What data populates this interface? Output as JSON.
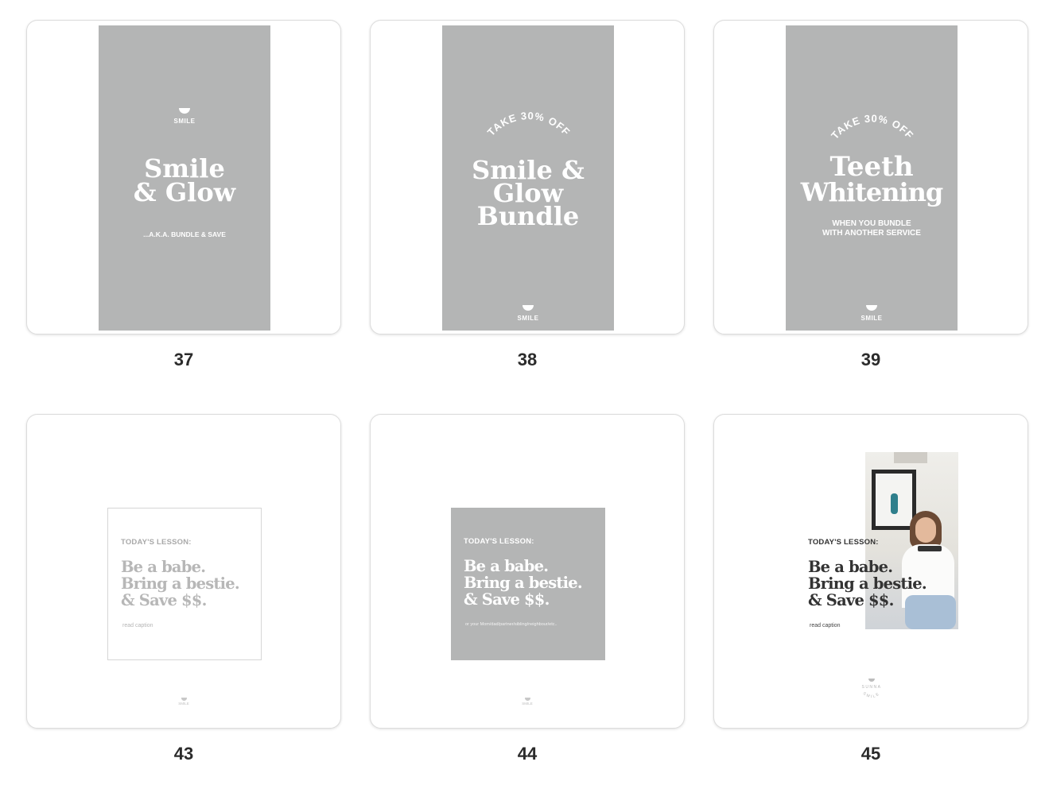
{
  "grid": {
    "cards": [
      {
        "number": "37",
        "logo": "SMILE",
        "title_lines": [
          "Smile",
          "& Glow"
        ],
        "subtitle": "...A.K.A. BUNDLE & SAVE"
      },
      {
        "number": "38",
        "arc": "TAKE 30% OFF",
        "title_lines": [
          "Smile &",
          "Glow",
          "Bundle"
        ],
        "logo": "SMILE"
      },
      {
        "number": "39",
        "arc": "TAKE 30% OFF",
        "title_lines": [
          "Teeth",
          "Whitening"
        ],
        "subtitle_lines": [
          "WHEN YOU BUNDLE",
          "WITH ANOTHER SERVICE"
        ],
        "logo": "SMILE"
      },
      {
        "number": "43",
        "lesson": "TODAY'S LESSON:",
        "lines": [
          "Be a babe.",
          "Bring a bestie.",
          "& Save $$."
        ],
        "caption": "read caption",
        "logo": "SMILE"
      },
      {
        "number": "44",
        "lesson": "TODAY'S LESSON:",
        "lines": [
          "Be a babe.",
          "Bring a bestie.",
          "& Save $$."
        ],
        "caption": "or your Mom/dad/partner/sibling/neighbour/etc..",
        "logo": "SMILE"
      },
      {
        "number": "45",
        "lesson": "TODAY'S LESSON:",
        "lines": [
          "Be a babe.",
          "Bring a bestie.",
          "& Save $$."
        ],
        "caption": "read caption",
        "logo": "SUNNA SMILE"
      }
    ]
  },
  "colors": {
    "panel": "#b4b5b5",
    "text_dark": "#333333",
    "border": "#dcdcdc"
  }
}
